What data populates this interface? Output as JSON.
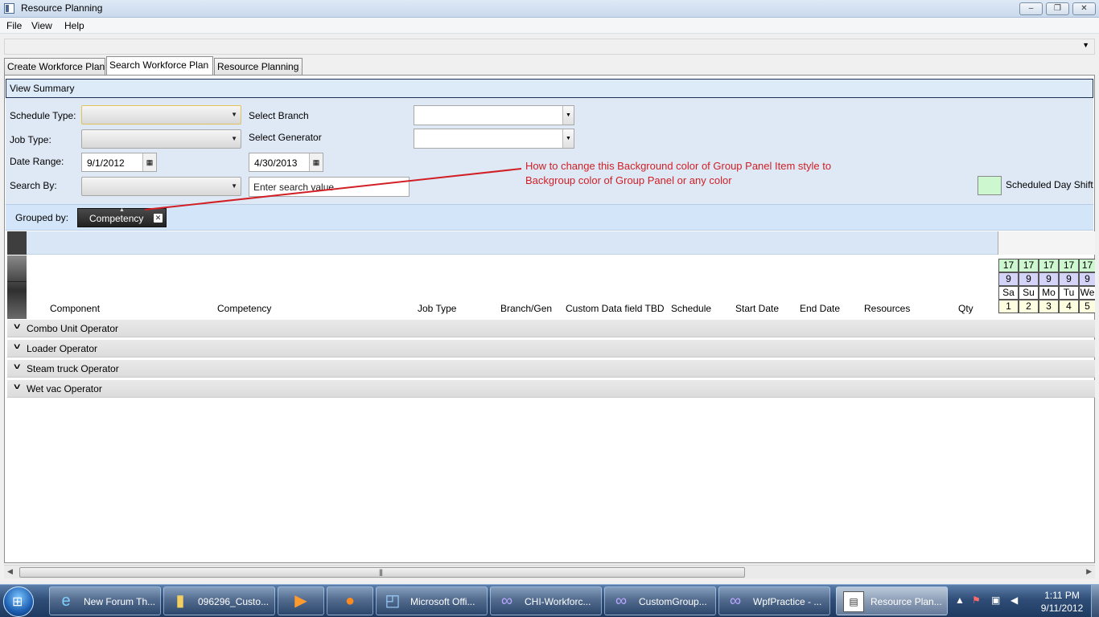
{
  "window": {
    "title": "Resource Planning",
    "controls": {
      "minimize": "‒",
      "maximize": "❐",
      "close": "✕"
    }
  },
  "menu": [
    "File",
    "View",
    "Help"
  ],
  "tabs": [
    {
      "label": "Create Workforce Plan",
      "active": false
    },
    {
      "label": "Search Workforce Plan",
      "active": true
    },
    {
      "label": "Resource Planning",
      "active": false
    }
  ],
  "summary": {
    "label": "View Summary"
  },
  "filters": {
    "schedule_type_label": "Schedule Type:",
    "job_type_label": "Job Type:",
    "date_range_label": "Date Range:",
    "search_by_label": "Search By:",
    "select_branch_label": "Select Branch",
    "select_generator_label": "Select Generator",
    "date_from": "9/1/2012",
    "date_to": "4/30/2013",
    "search_placeholder": "Enter search value"
  },
  "annotation": "How to change this Background color of Group Panel Item style to Backgroup color of Group Panel or any color",
  "legend": {
    "label": "Scheduled Day Shift",
    "color": "#ccf7cf"
  },
  "group_panel": {
    "label": "Grouped by:",
    "chip": "Competency"
  },
  "columns": [
    "Component",
    "Competency",
    "Job Type",
    "Branch/Gen",
    "Custom Data field TBD",
    "Schedule",
    "Start Date",
    "End Date",
    "Resources",
    "Qty"
  ],
  "calendar": {
    "row1": [
      "17",
      "17",
      "17",
      "17",
      "17"
    ],
    "row2": [
      "9",
      "9",
      "9",
      "9",
      "9"
    ],
    "row3": [
      "Sa",
      "Su",
      "Mo",
      "Tu",
      "We"
    ],
    "row4": [
      "1",
      "2",
      "3",
      "4",
      "5"
    ],
    "colors": {
      "row1": "#ccf7cf",
      "row2": "#d4d4f8",
      "row3": "#ffffff",
      "row4": "#fdfde0"
    }
  },
  "groups": [
    "Combo Unit Operator",
    "Loader Operator",
    "Steam truck Operator",
    "Wet vac Operator"
  ],
  "scrollbar_grip": "|||",
  "taskbar": {
    "items": [
      {
        "label": "New Forum Th...",
        "icon": "ie-icon"
      },
      {
        "label": "096296_Custo...",
        "icon": "folder-icon"
      },
      {
        "label": "",
        "icon": "media-player-icon"
      },
      {
        "label": "",
        "icon": "firefox-icon"
      },
      {
        "label": "Microsoft Offi...",
        "icon": "office-icon"
      },
      {
        "label": "CHI-Workforc...",
        "icon": "visual-studio-icon"
      },
      {
        "label": "CustomGroup...",
        "icon": "visual-studio-icon"
      },
      {
        "label": "WpfPractice - ...",
        "icon": "visual-studio-icon"
      },
      {
        "label": "Resource Plan...",
        "icon": "app-window-icon",
        "active": true
      }
    ],
    "time": "1:11 PM",
    "date": "9/11/2012"
  }
}
